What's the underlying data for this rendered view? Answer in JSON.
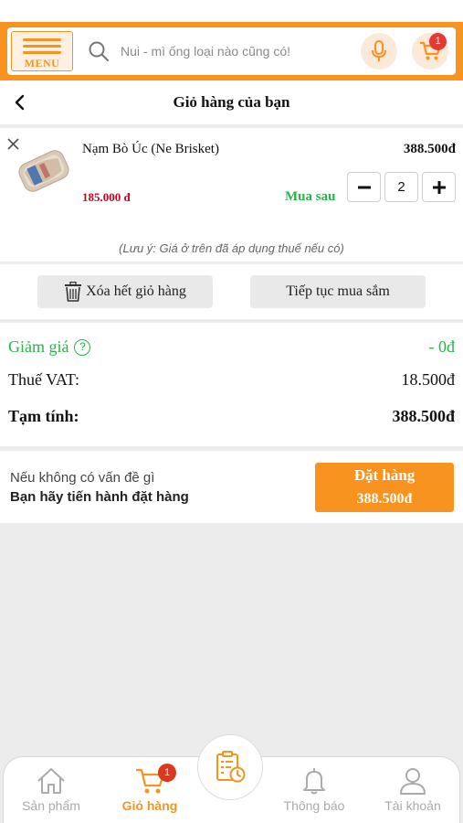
{
  "search": {
    "menu_label": "MENU",
    "placeholder": "Nui - mì ống loại nào cũng có!",
    "cart_count": "1"
  },
  "header": {
    "title": "Giỏ hàng của bạn"
  },
  "cart": {
    "items": [
      {
        "name": "Nạm Bò Úc (Ne Brisket)",
        "unit_price": "185.000 đ",
        "total": "388.500đ",
        "quantity": "2",
        "buy_later_label": "Mua sau"
      }
    ],
    "tax_note": "(Lưu ý: Giá ở trên đã áp dụng thuế nếu có)"
  },
  "actions": {
    "clear_label": "Xóa hết giỏ hàng",
    "continue_label": "Tiếp tục mua sắm"
  },
  "summary": {
    "discount_label": "Giảm giá",
    "discount_value": "- 0đ",
    "vat_label": "Thuế VAT:",
    "vat_value": "18.500đ",
    "subtotal_label": "Tạm tính:",
    "subtotal_value": "388.500đ"
  },
  "order": {
    "message_line1": "Nếu không có vấn đề gì",
    "message_line2": "Bạn hãy tiến hành đặt hàng",
    "button_label": "Đặt hàng",
    "button_total": "388.500đ"
  },
  "bottom_nav": {
    "items": [
      {
        "label": "Sản phẩm",
        "icon": "home-icon",
        "active": false
      },
      {
        "label": "Giỏ hàng",
        "icon": "cart-icon",
        "active": true,
        "badge": "1"
      },
      {
        "label": "Thông báo",
        "icon": "bell-icon",
        "active": false
      },
      {
        "label": "Tài khoản",
        "icon": "user-icon",
        "active": false
      }
    ],
    "center_icon": "order-history-icon"
  },
  "colors": {
    "brand": "#f7931e",
    "price_red": "#d0021b",
    "green": "#2ab34a",
    "badge_red": "#e53935"
  }
}
